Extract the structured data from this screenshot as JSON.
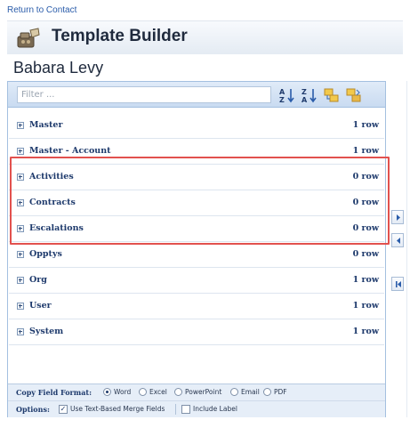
{
  "header": {
    "return_link": "Return to Contact",
    "title": "Template Builder",
    "contact_name": "Babara Levy"
  },
  "toolbar": {
    "filter_placeholder": "Filter ...",
    "buttons": [
      "sort-ascending-icon",
      "sort-descending-icon",
      "expand-all-icon",
      "collapse-all-icon"
    ]
  },
  "rows": [
    {
      "label": "Master",
      "count": "1 row"
    },
    {
      "label": "Master - Account",
      "count": "1 row"
    },
    {
      "label": "Activities",
      "count": "0 row"
    },
    {
      "label": "Contracts",
      "count": "0 row"
    },
    {
      "label": "Escalations",
      "count": "0 row"
    },
    {
      "label": "Opptys",
      "count": "0 row"
    },
    {
      "label": "Org",
      "count": "1 row"
    },
    {
      "label": "User",
      "count": "1 row"
    },
    {
      "label": "System",
      "count": "1 row"
    }
  ],
  "copy_format": {
    "label": "Copy Field Format:",
    "selected": "Word",
    "options": [
      "Word",
      "Excel",
      "PowerPoint",
      "Email",
      "PDF"
    ]
  },
  "options": {
    "label": "Options:",
    "text_merge": {
      "label": "Use Text-Based Merge Fields",
      "checked": true
    },
    "include_label": {
      "label": "Include Label",
      "checked": false
    }
  },
  "side_buttons": [
    "arrow-right-icon",
    "arrow-left-icon",
    "arrow-first-icon"
  ],
  "colors": {
    "highlight": "#e2514e",
    "accent": "#1e3a6c",
    "panel_border": "#a4c0e0"
  }
}
